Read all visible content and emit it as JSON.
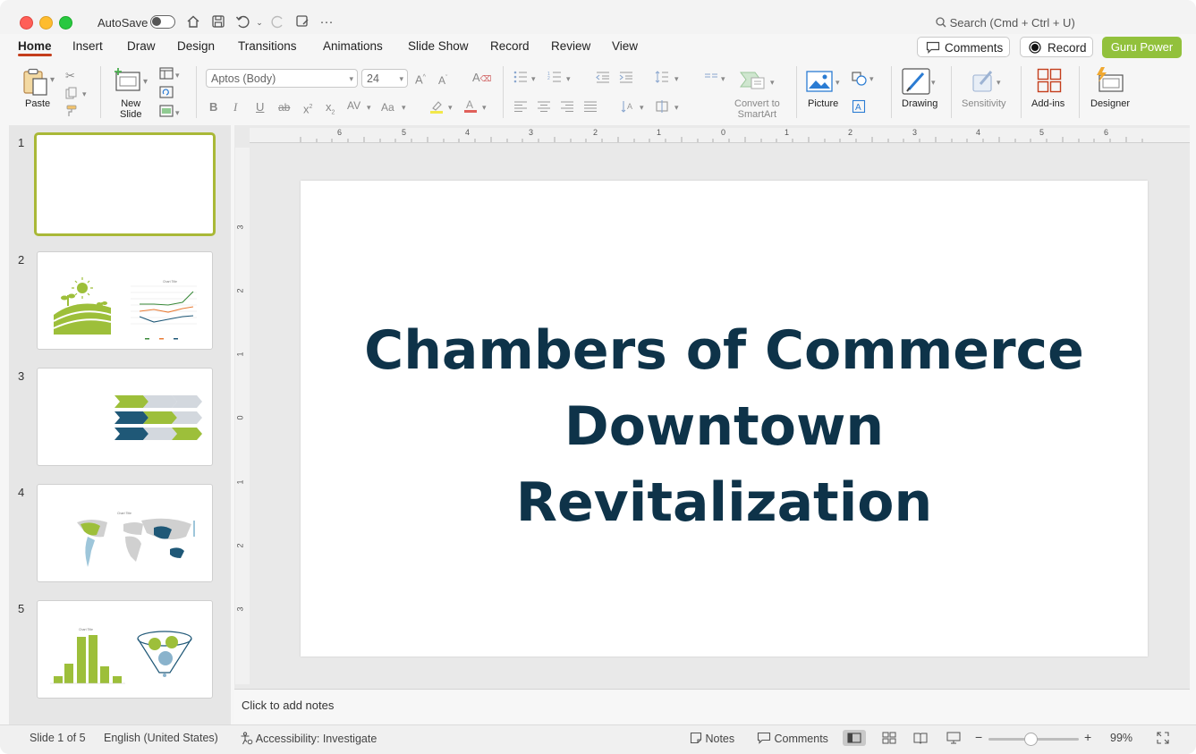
{
  "titlebar": {
    "autosave_label": "AutoSave",
    "search_placeholder": "Search (Cmd + Ctrl + U)"
  },
  "tabs": [
    "Home",
    "Insert",
    "Draw",
    "Design",
    "Transitions",
    "Animations",
    "Slide Show",
    "Record",
    "Review",
    "View"
  ],
  "header_buttons": {
    "comments": "Comments",
    "record": "Record",
    "guru": "Guru Power"
  },
  "ribbon": {
    "paste": "Paste",
    "new_slide_line1": "New",
    "new_slide_line2": "Slide",
    "font_name": "Aptos (Body)",
    "font_size": "24",
    "convert_line1": "Convert to",
    "convert_line2": "SmartArt",
    "picture": "Picture",
    "drawing": "Drawing",
    "sensitivity": "Sensitivity",
    "addins": "Add-ins",
    "designer": "Designer"
  },
  "slides_panel": {
    "numbers": [
      "1",
      "2",
      "3",
      "4",
      "5"
    ],
    "thumb2_chart_title": "Chart Title",
    "thumb4_chart_title": "Chart Title",
    "thumb5_chart_title": "Chart Title"
  },
  "slide": {
    "title_line1": "Chambers of Commerce",
    "title_line2": "Downtown",
    "title_line3": "Revitalization"
  },
  "ruler": {
    "h_ticks": [
      "6",
      "5",
      "4",
      "3",
      "2",
      "1",
      "0",
      "1",
      "2",
      "3",
      "4",
      "5",
      "6"
    ],
    "v_ticks": [
      "3",
      "2",
      "1",
      "0",
      "1",
      "2",
      "3"
    ]
  },
  "notes_placeholder": "Click to add notes",
  "status": {
    "slide_info": "Slide 1 of 5",
    "language": "English (United States)",
    "accessibility": "Accessibility: Investigate",
    "notes": "Notes",
    "comments": "Comments",
    "zoom_minus": "−",
    "zoom_plus": "+",
    "zoom": "99%",
    "zoom_fraction": 0.47
  },
  "colors": {
    "accent_red": "#c43e1c",
    "guru_green": "#92c13c",
    "title_navy": "#0e3349",
    "selection_olive": "#a9b837",
    "chart_green": "#9dbf3a",
    "chart_navy": "#1f5877",
    "chart_gray": "#d3d8de"
  }
}
